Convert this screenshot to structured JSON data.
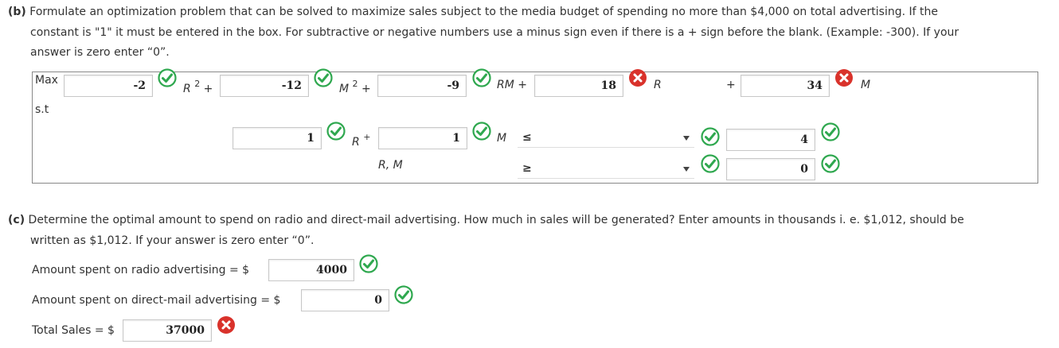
{
  "part_b": {
    "label": "(b)",
    "text1": " Formulate an optimization problem that can be solved to maximize sales subject to the media budget of spending no more than $4,000 on total advertising. If the",
    "text2": "constant is \"1\" it must be entered in the box. For subtractive or negative numbers use a minus sign even if there is a + sign before the blank. (Example: -300). If your",
    "text3": "answer is zero enter “0”."
  },
  "model": {
    "max_label": "Max",
    "st_label": "s.t",
    "objective": [
      {
        "value": "-2",
        "term": "R",
        "exp": "2",
        "op": "+",
        "status": "correct"
      },
      {
        "value": "-12",
        "term": "M",
        "exp": "2",
        "op": "+",
        "status": "correct"
      },
      {
        "value": "-9",
        "term": "RM",
        "exp": "",
        "op": "+",
        "status": "correct"
      },
      {
        "value": "18",
        "term": "R",
        "exp": "",
        "op": "",
        "status": "incorrect"
      },
      {
        "value": "34",
        "term": "M",
        "exp": "",
        "op": "",
        "status": "incorrect"
      }
    ],
    "plus_sign": "+",
    "constraint1": {
      "r_coef": "1",
      "r_term": "R",
      "plus": "+",
      "m_coef": "1",
      "m_term": "M",
      "relation": "≤",
      "rhs": "4"
    },
    "constraint2": {
      "vars": "R, M",
      "relation": "≥",
      "rhs": "0"
    }
  },
  "part_c": {
    "label": "(c)",
    "text1": " Determine the optimal amount to spend on radio and direct-mail advertising. How much in sales will be generated? Enter amounts in thousands i. e. $1,012, should be",
    "text2": "written as $1,012. If your answer is zero enter “0”.",
    "radio_label": "Amount spent on radio advertising = $",
    "radio_value": "4000",
    "mail_label": "Amount spent on direct-mail advertising = $",
    "mail_value": "0",
    "sales_label": "Total Sales = $",
    "sales_value": "37000"
  },
  "colors": {
    "correct": "#2fa84f",
    "incorrect": "#d9322b"
  }
}
